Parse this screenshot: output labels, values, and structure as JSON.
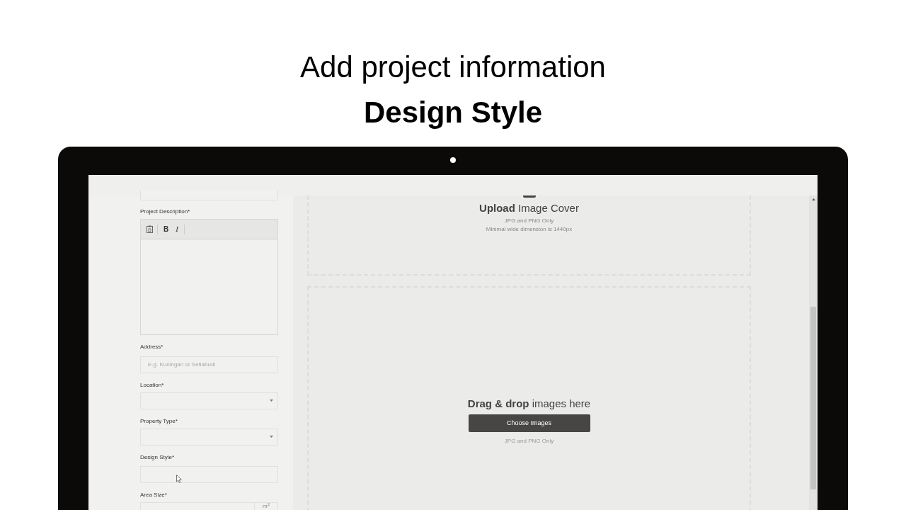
{
  "heading": "Add project information",
  "subheading": "Design Style",
  "form": {
    "fields": [
      {
        "kind": "editor",
        "label": "Project Description*",
        "tools": [
          "B",
          "I"
        ]
      },
      {
        "kind": "text",
        "label": "Address*",
        "placeholder": "E.g. Kuningan or Setiabudi"
      },
      {
        "kind": "select",
        "label": "Location*"
      },
      {
        "kind": "select",
        "label": "Property Type*"
      },
      {
        "kind": "text",
        "label": "Design Style*",
        "hovered": true
      },
      {
        "kind": "unit",
        "label": "Area Size*",
        "unit": "m$^{2}$"
      }
    ]
  },
  "cover_upload": {
    "title_bold": "Upload",
    "title_rest": "Image Cover",
    "lines": [
      "JPG and PNG Only",
      "Minimal wide dimension is 1440px"
    ]
  },
  "dropzone": {
    "title_bold": "Drag & drop",
    "title_rest": "images here",
    "button": "Choose Images",
    "note": "JPG and PNG Only"
  }
}
